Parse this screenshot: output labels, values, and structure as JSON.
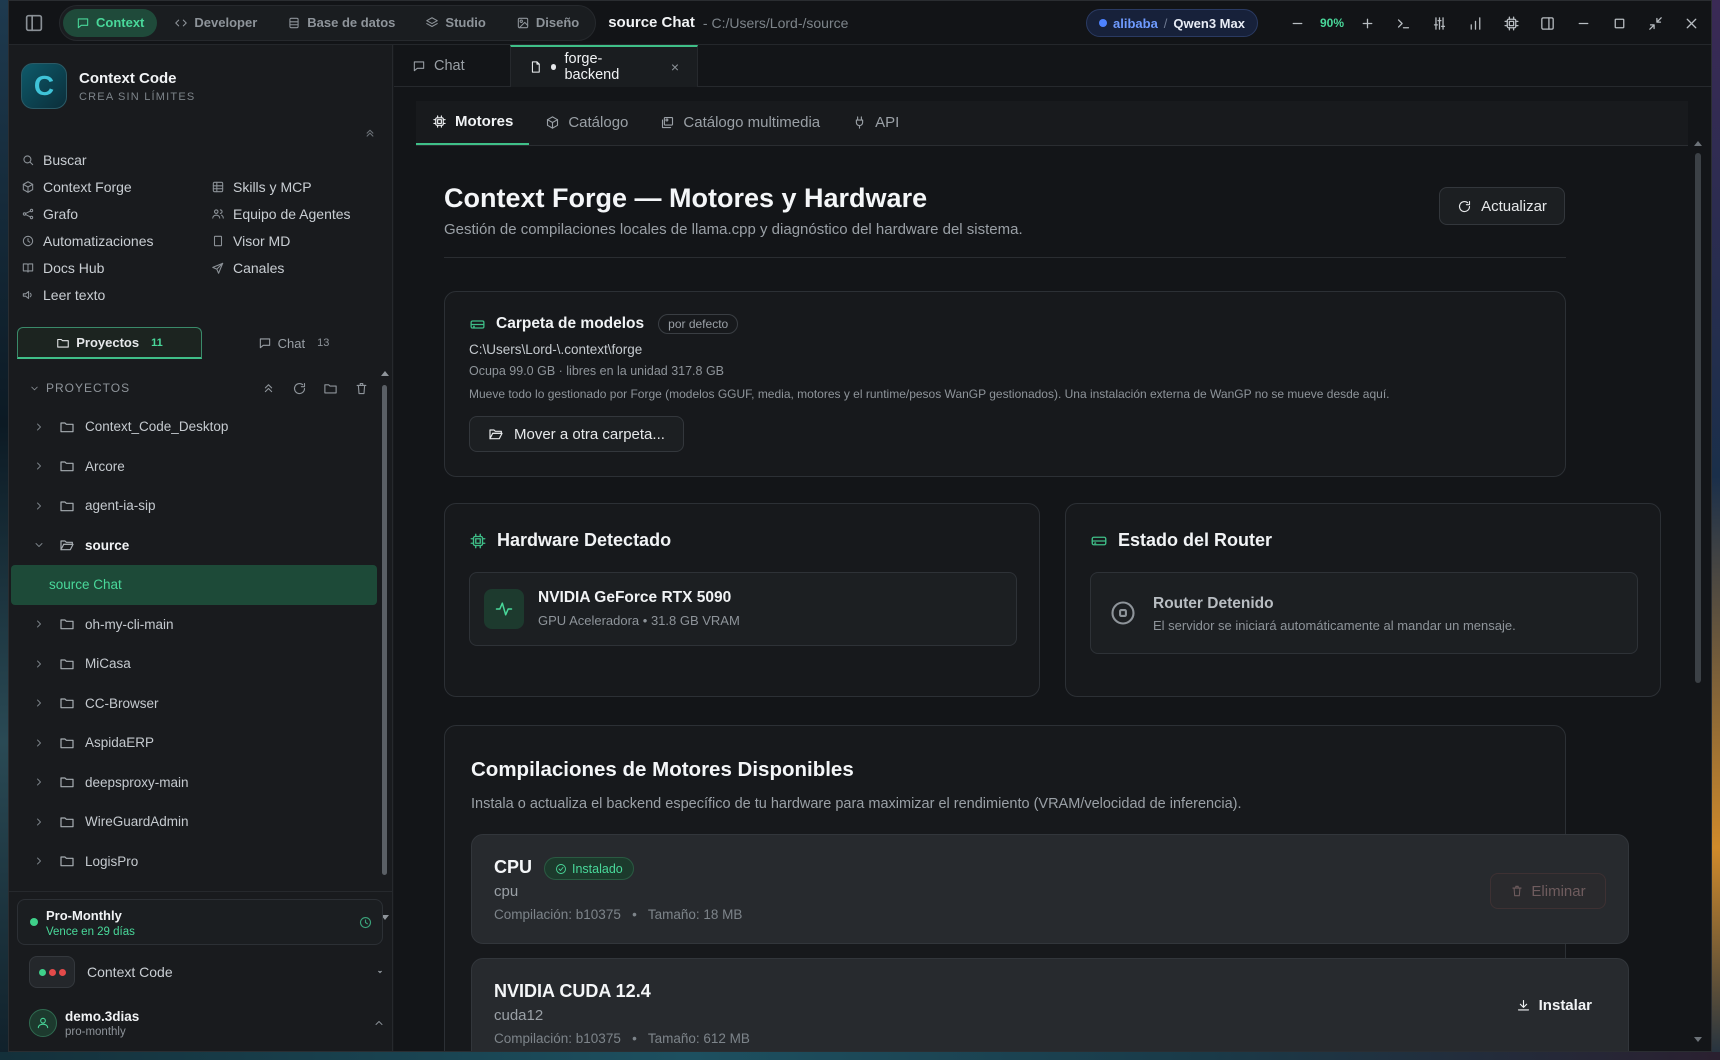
{
  "titlebar": {
    "modes": [
      {
        "label": "Context",
        "icon": "chat-icon",
        "active": true
      },
      {
        "label": "Developer",
        "icon": "code-icon"
      },
      {
        "label": "Base de datos",
        "icon": "database-icon"
      },
      {
        "label": "Studio",
        "icon": "layers-icon"
      },
      {
        "label": "Diseño",
        "icon": "image-icon"
      }
    ],
    "title": "source Chat",
    "path": "- C:/Users/Lord-/source",
    "provider": "alibaba",
    "separator": "/",
    "model": "Qwen3 Max",
    "zoom": "90%"
  },
  "sidebar": {
    "brand": {
      "name": "Context Code",
      "tagline": "CREA SIN LÍMITES",
      "logo_letter": "C"
    },
    "nav_left": [
      "Buscar",
      "Context Forge",
      "Grafo",
      "Automatizaciones",
      "Docs Hub",
      "Leer texto"
    ],
    "nav_right": [
      "Skills y MCP",
      "Equipo de Agentes",
      "Visor MD",
      "Canales"
    ],
    "tabs": {
      "projects": "Proyectos",
      "projects_count": "11",
      "chat": "Chat",
      "chat_count": "13"
    },
    "projects_header": "PROYECTOS",
    "projects": [
      "Context_Code_Desktop",
      "Arcore",
      "agent-ia-sip",
      "source",
      "source Chat",
      "oh-my-cli-main",
      "MiCasa",
      "CC-Browser",
      "AspidaERP",
      "deepsproxy-main",
      "WireGuardAdmin",
      "LogisPro"
    ],
    "plan": {
      "name": "Pro-Monthly",
      "expires": "Vence en 29 días"
    },
    "workspace": "Context Code",
    "user": {
      "name": "demo.3dias",
      "plan": "pro-monthly"
    }
  },
  "main": {
    "doc_tabs": {
      "chat": "Chat",
      "active": "forge-backend",
      "close": "×"
    },
    "sub_tabs": [
      "Motores",
      "Catálogo",
      "Catálogo multimedia",
      "API"
    ],
    "title": "Context Forge — Motores y Hardware",
    "subtitle": "Gestión de compilaciones locales de llama.cpp y diagnóstico del hardware del sistema.",
    "refresh": "Actualizar",
    "models_folder": {
      "title": "Carpeta de modelos",
      "badge": "por defecto",
      "path": "C:\\Users\\Lord-\\.context\\forge",
      "usage": "Ocupa 99.0 GB · libres en la unidad 317.8 GB",
      "note": "Mueve todo lo gestionado por Forge (modelos GGUF, media, motores y el runtime/pesos WanGP gestionados). Una instalación externa de WanGP no se mueve desde aquí.",
      "move_button": "Mover a otra carpeta..."
    },
    "hardware": {
      "title": "Hardware Detectado",
      "gpu_name": "NVIDIA GeForce RTX 5090",
      "gpu_desc": "GPU Aceleradora • 31.8 GB VRAM"
    },
    "router": {
      "title": "Estado del Router",
      "status": "Router Detenido",
      "desc": "El servidor se iniciará automáticamente al mandar un mensaje."
    },
    "engines": {
      "title": "Compilaciones de Motores Disponibles",
      "desc": "Instala o actualiza el backend específico de tu hardware para maximizar el rendimiento (VRAM/velocidad de inferencia).",
      "items": [
        {
          "name": "CPU",
          "id": "cpu",
          "badge": "Instalado",
          "meta": "Compilación: b10375   •   Tamaño: 18 MB",
          "action": "Eliminar"
        },
        {
          "name": "NVIDIA CUDA 12.4",
          "id": "cuda12",
          "meta": "Compilación: b10375   •   Tamaño: 612 MB",
          "action": "Instalar"
        }
      ]
    }
  }
}
